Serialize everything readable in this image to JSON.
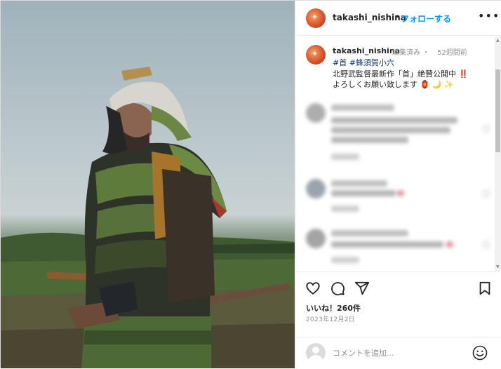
{
  "post": {
    "username": "takashi_nishina",
    "follow_label": "フォローする",
    "separator": "•",
    "more_label": "•••"
  },
  "caption": {
    "username": "takashi_nishina",
    "edited": "編集済み ・",
    "time": "52週間前",
    "hashtags": "#首 #蜂須賀小六",
    "line1": "北野武監督最新作「首」絶賛公開中 ‼️",
    "line2": "よろしくお願い致します 🏮 🌙 ✨"
  },
  "actions": {
    "like_icon": "heart-icon",
    "comment_icon": "comment-icon",
    "share_icon": "share-icon",
    "save_icon": "bookmark-icon",
    "likes": "いいね！260件",
    "date": "2023年12月2日"
  },
  "comment_box": {
    "placeholder": "コメントを追加...",
    "emoji_icon": "smiley-icon"
  },
  "colors": {
    "accent": "#0095f6",
    "hashtag": "#00376b",
    "muted": "#8e8e8e"
  }
}
